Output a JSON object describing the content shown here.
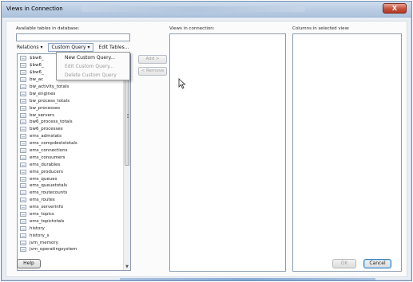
{
  "window": {
    "title": "Views in Connection",
    "close_glyph": "X"
  },
  "labels": {
    "available_tables": "Available tables in database:",
    "views_in_connection": "Views in connection:",
    "columns_in_view": "Columns in selected view:"
  },
  "search": {
    "value": ""
  },
  "toolbar": {
    "relations": "Relations ▾",
    "custom_query": "Custom Query ▾",
    "edit_tables": "Edit Tables..."
  },
  "custom_query_menu": {
    "items": [
      {
        "label": "New Custom Query...",
        "enabled": true
      },
      {
        "label": "Edit Custom Query...",
        "enabled": false
      },
      {
        "label": "Delete Custom Query",
        "enabled": false
      }
    ]
  },
  "tables": [
    "$bw6_",
    "$bw6_",
    "$bw6_",
    "bw_ac",
    "bw_activity_totals",
    "bw_engines",
    "bw_process_totals",
    "bw_processes",
    "bw_servers",
    "bw6_process_totals",
    "bw6_processes",
    "ems_admstats",
    "ems_compdeststotals",
    "ems_connections",
    "ems_consumers",
    "ems_durables",
    "ems_producers",
    "ems_queues",
    "ems_queuetotals",
    "ems_routecounts",
    "ems_routes",
    "ems_serverinfo",
    "ems_topics",
    "ems_topictotals",
    "history",
    "history_s",
    "jvm_memory",
    "jvm_operatingsystem"
  ],
  "move_buttons": {
    "add": "Add >",
    "remove": "< Remove"
  },
  "footer": {
    "help": "Help",
    "ok": "OK",
    "cancel": "Cancel"
  },
  "colors": {
    "title_bar": "#b8cbe2",
    "close_button": "#c7503a",
    "panel_border": "#8a9bb0"
  }
}
